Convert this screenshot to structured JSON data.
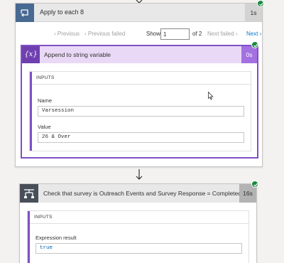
{
  "apply_each": {
    "title": "Apply to each 8",
    "duration": "1s",
    "pager": {
      "previous": "Previous",
      "previous_failed": "Previous failed",
      "show_label": "Show",
      "page_value": "1",
      "of_total": "of 2",
      "next_failed": "Next failed",
      "next": "Next"
    }
  },
  "append": {
    "title": "Append to string variable",
    "duration": "0s",
    "icon_text": "{x}",
    "inputs_heading": "INPUTS",
    "name_label": "Name",
    "name_value": "Varsession",
    "value_label": "Value",
    "value_value": "26 & Over"
  },
  "check": {
    "title": "Check that survey is Outreach Events and Survey Response = Completed",
    "duration": "16s",
    "inputs_heading": "INPUTS",
    "result_label": "Expression result",
    "result_value": "true"
  },
  "colors": {
    "loop_icon": "#486991",
    "variable_accent": "#7f4fc7",
    "condition_icon": "#484f58",
    "success": "#198a3e",
    "link": "#0078d4"
  }
}
